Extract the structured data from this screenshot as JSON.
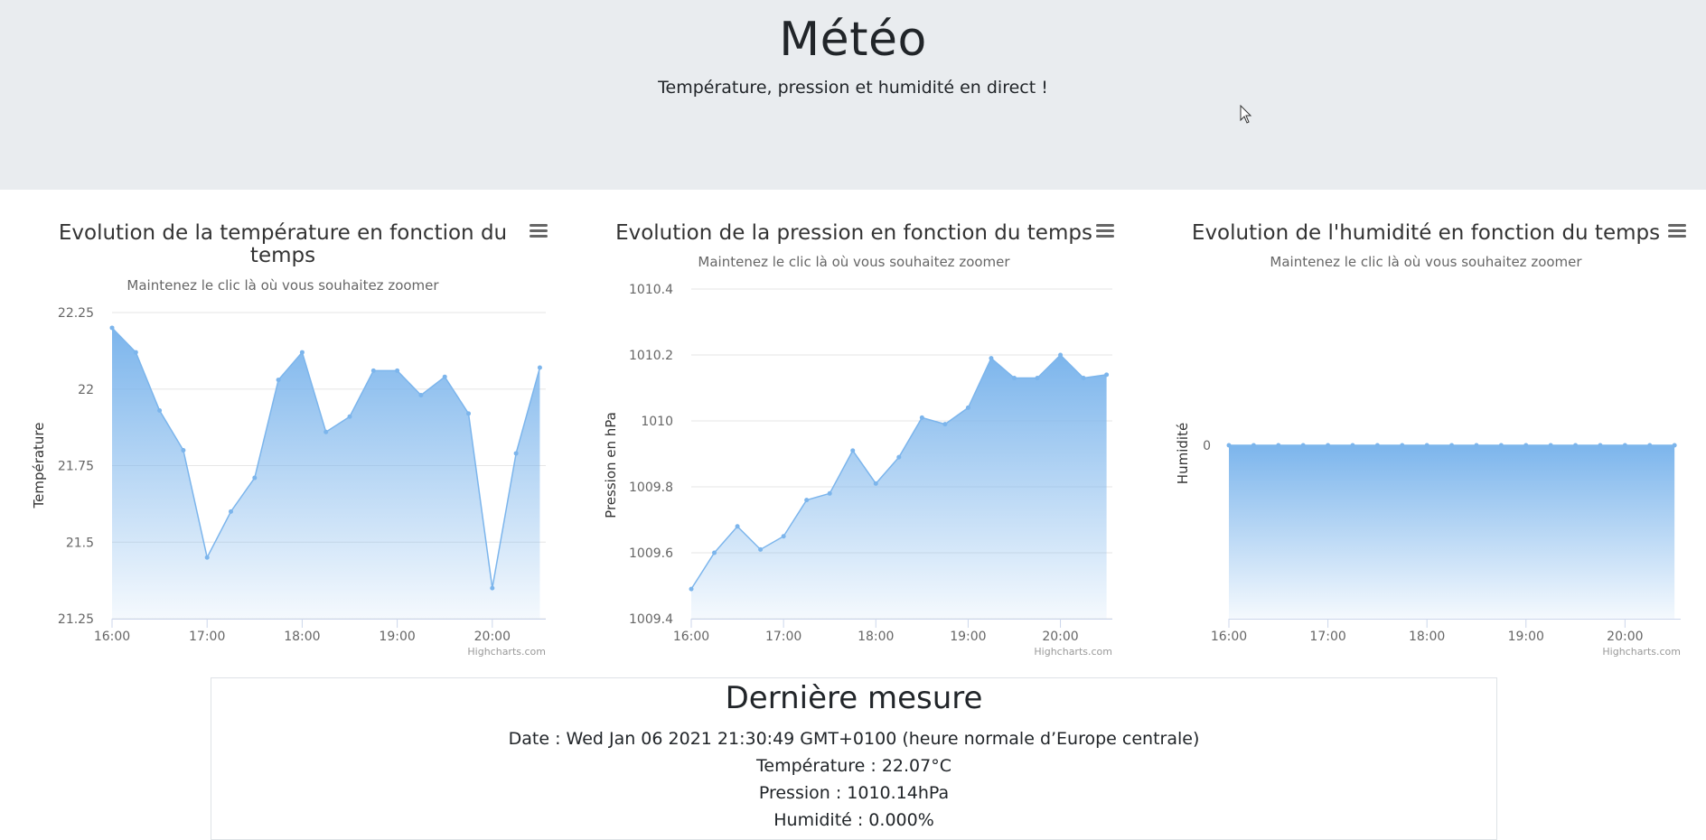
{
  "header": {
    "title": "Météo",
    "subtitle": "Température, pression et humidité en direct !"
  },
  "colors": {
    "series": "#7cb5ec",
    "grid": "#e6e6e6",
    "axis": "#ccd6eb",
    "text": "#333333",
    "muted": "#666666"
  },
  "chart_data": [
    {
      "type": "area",
      "title_lines": [
        "Evolution de la température en fonction du",
        "temps"
      ],
      "subtitle": "Maintenez le clic là où vous souhaitez zoomer",
      "ylabel": "Température",
      "credits": "Highcharts.com",
      "menu_icon": "hamburger-menu-icon",
      "x": [
        "16:00",
        "16:15",
        "16:30",
        "16:45",
        "17:00",
        "17:15",
        "17:30",
        "17:45",
        "18:00",
        "18:15",
        "18:30",
        "18:45",
        "19:00",
        "19:15",
        "19:30",
        "19:45",
        "20:00",
        "20:15",
        "20:30"
      ],
      "x_ticks": [
        "16:00",
        "17:00",
        "18:00",
        "19:00",
        "20:00"
      ],
      "ylim": [
        21.25,
        22.25
      ],
      "y_ticks": [
        "21.25",
        "21.5",
        "21.75",
        "22",
        "22.25"
      ],
      "values": [
        22.2,
        22.12,
        21.93,
        21.8,
        21.45,
        21.6,
        21.71,
        22.03,
        22.12,
        21.86,
        21.91,
        22.06,
        22.06,
        21.98,
        22.04,
        21.92,
        21.35,
        21.79,
        22.07
      ],
      "grid": true
    },
    {
      "type": "area",
      "title_lines": [
        "Evolution de la pression en fonction du temps"
      ],
      "subtitle": "Maintenez le clic là où vous souhaitez zoomer",
      "ylabel": "Pression en hPa",
      "credits": "Highcharts.com",
      "menu_icon": "hamburger-menu-icon",
      "x": [
        "16:00",
        "16:15",
        "16:30",
        "16:45",
        "17:00",
        "17:15",
        "17:30",
        "17:45",
        "18:00",
        "18:15",
        "18:30",
        "18:45",
        "19:00",
        "19:15",
        "19:30",
        "19:45",
        "20:00",
        "20:15",
        "20:30"
      ],
      "x_ticks": [
        "16:00",
        "17:00",
        "18:00",
        "19:00",
        "20:00"
      ],
      "ylim": [
        1009.4,
        1010.4
      ],
      "y_ticks": [
        "1009.4",
        "1009.6",
        "1009.8",
        "1010",
        "1010.2",
        "1010.4"
      ],
      "values": [
        1009.49,
        1009.6,
        1009.68,
        1009.61,
        1009.65,
        1009.76,
        1009.78,
        1009.91,
        1009.81,
        1009.89,
        1010.01,
        1009.99,
        1010.04,
        1010.19,
        1010.13,
        1010.13,
        1010.2,
        1010.13,
        1010.14
      ],
      "grid": true
    },
    {
      "type": "area",
      "title_lines": [
        "Evolution de l'humidité en fonction du temps"
      ],
      "subtitle": "Maintenez le clic là où vous souhaitez zoomer",
      "ylabel": "Humidité",
      "credits": "Highcharts.com",
      "menu_icon": "hamburger-menu-icon",
      "x": [
        "16:00",
        "16:15",
        "16:30",
        "16:45",
        "17:00",
        "17:15",
        "17:30",
        "17:45",
        "18:00",
        "18:15",
        "18:30",
        "18:45",
        "19:00",
        "19:15",
        "19:30",
        "19:45",
        "20:00",
        "20:15",
        "20:30"
      ],
      "x_ticks": [
        "16:00",
        "17:00",
        "18:00",
        "19:00",
        "20:00"
      ],
      "ylim": [
        0,
        0
      ],
      "y_ticks": [
        "0"
      ],
      "values": [
        0,
        0,
        0,
        0,
        0,
        0,
        0,
        0,
        0,
        0,
        0,
        0,
        0,
        0,
        0,
        0,
        0,
        0,
        0
      ],
      "grid": false
    }
  ],
  "last": {
    "title": "Dernière mesure",
    "date": "Date : Wed Jan 06 2021 21:30:49 GMT+0100 (heure normale d’Europe centrale)",
    "temperature": "Température : 22.07°C",
    "pression": "Pression : 1010.14hPa",
    "humidite": "Humidité : 0.000%"
  }
}
